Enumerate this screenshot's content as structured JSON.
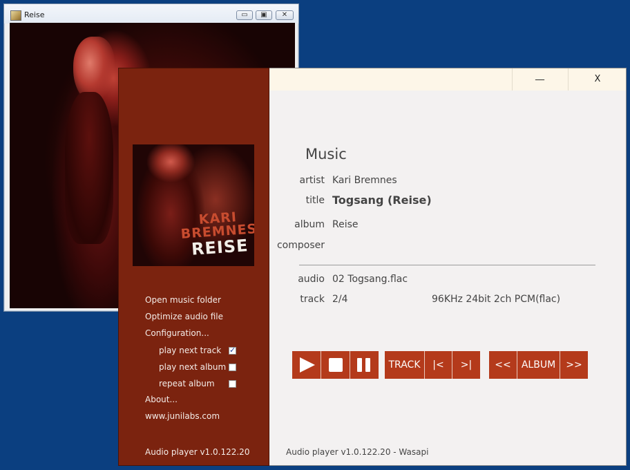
{
  "viewer": {
    "title": "Reise",
    "icon": "image-viewer-icon",
    "buttons": {
      "minimize": "▭",
      "maximize": "▣",
      "close": "✕"
    },
    "photo": "concert-photo"
  },
  "window": {
    "minimize_label": "__",
    "close_label": "X"
  },
  "sidebar": {
    "cover_art": {
      "artist_text_1": "KARI",
      "artist_text_2": "BREMNES",
      "album_text": "REISE"
    },
    "menu": [
      {
        "label": "Open music folder"
      },
      {
        "label": "Optimize audio file"
      },
      {
        "label": "Configuration..."
      }
    ],
    "options": [
      {
        "label": "play next track",
        "checked": true
      },
      {
        "label": "play next album",
        "checked": false
      },
      {
        "label": "repeat album",
        "checked": false
      }
    ],
    "about_label": "About...",
    "website_label": "www.junilabs.com",
    "version": "Audio player v1.0.122.20"
  },
  "info": {
    "heading": "Music",
    "artist_label": "artist",
    "artist": "Kari Bremnes",
    "title_label": "title",
    "title": "Togsang (Reise)",
    "album_label": "album",
    "album": "Reise",
    "composer_label": "composer",
    "composer": "",
    "audio_label": "audio",
    "audio": "02 Togsang.flac",
    "track_label": "track",
    "track": "2/4",
    "format": "96KHz 24bit 2ch PCM(flac)"
  },
  "controls": {
    "play_icon": "play-icon",
    "stop_icon": "stop-icon",
    "pause_icon": "pause-icon",
    "track_label": "TRACK",
    "prev_track_label": "|<",
    "next_track_label": ">|",
    "prev_album_label": "<<",
    "album_label": "ALBUM",
    "next_album_label": ">>",
    "accent_color": "#b43a1b"
  },
  "status": "Audio player v1.0.122.20 - Wasapi"
}
